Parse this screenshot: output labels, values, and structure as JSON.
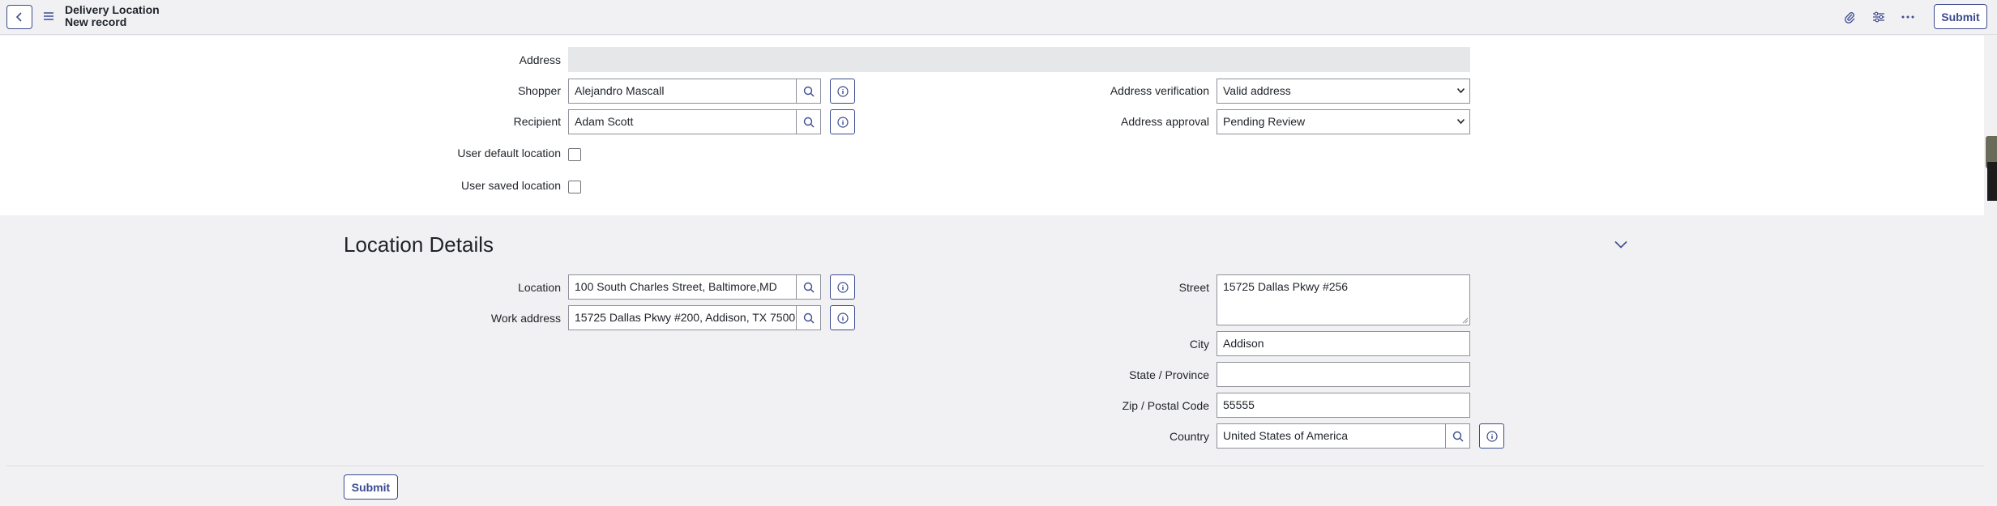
{
  "header": {
    "title": "Delivery Location",
    "subtitle": "New record",
    "submit_label": "Submit"
  },
  "form": {
    "address": {
      "label": "Address",
      "value": ""
    },
    "shopper": {
      "label": "Shopper",
      "value": "Alejandro Mascall"
    },
    "recipient": {
      "label": "Recipient",
      "value": "Adam Scott"
    },
    "user_default_location": {
      "label": "User default location",
      "checked": false
    },
    "user_saved_location": {
      "label": "User saved location",
      "checked": false
    },
    "address_verification": {
      "label": "Address verification",
      "value": "Valid address"
    },
    "address_approval": {
      "label": "Address approval",
      "value": "Pending Review"
    }
  },
  "location_details": {
    "title": "Location Details",
    "location": {
      "label": "Location",
      "value": "100 South Charles Street, Baltimore,MD"
    },
    "work_address": {
      "label": "Work address",
      "value": "15725 Dallas Pkwy #200, Addison, TX 7500"
    },
    "street": {
      "label": "Street",
      "value": "15725 Dallas Pkwy #256"
    },
    "city": {
      "label": "City",
      "value": "Addison"
    },
    "state": {
      "label": "State / Province",
      "value": ""
    },
    "zip": {
      "label": "Zip / Postal Code",
      "value": "55555"
    },
    "country": {
      "label": "Country",
      "value": "United States of America"
    }
  },
  "footer": {
    "submit_label": "Submit"
  },
  "colors": {
    "accent": "#3c4b8f",
    "header_bg": "#f1f1f3",
    "readonly_bg": "#e6e7e9"
  }
}
